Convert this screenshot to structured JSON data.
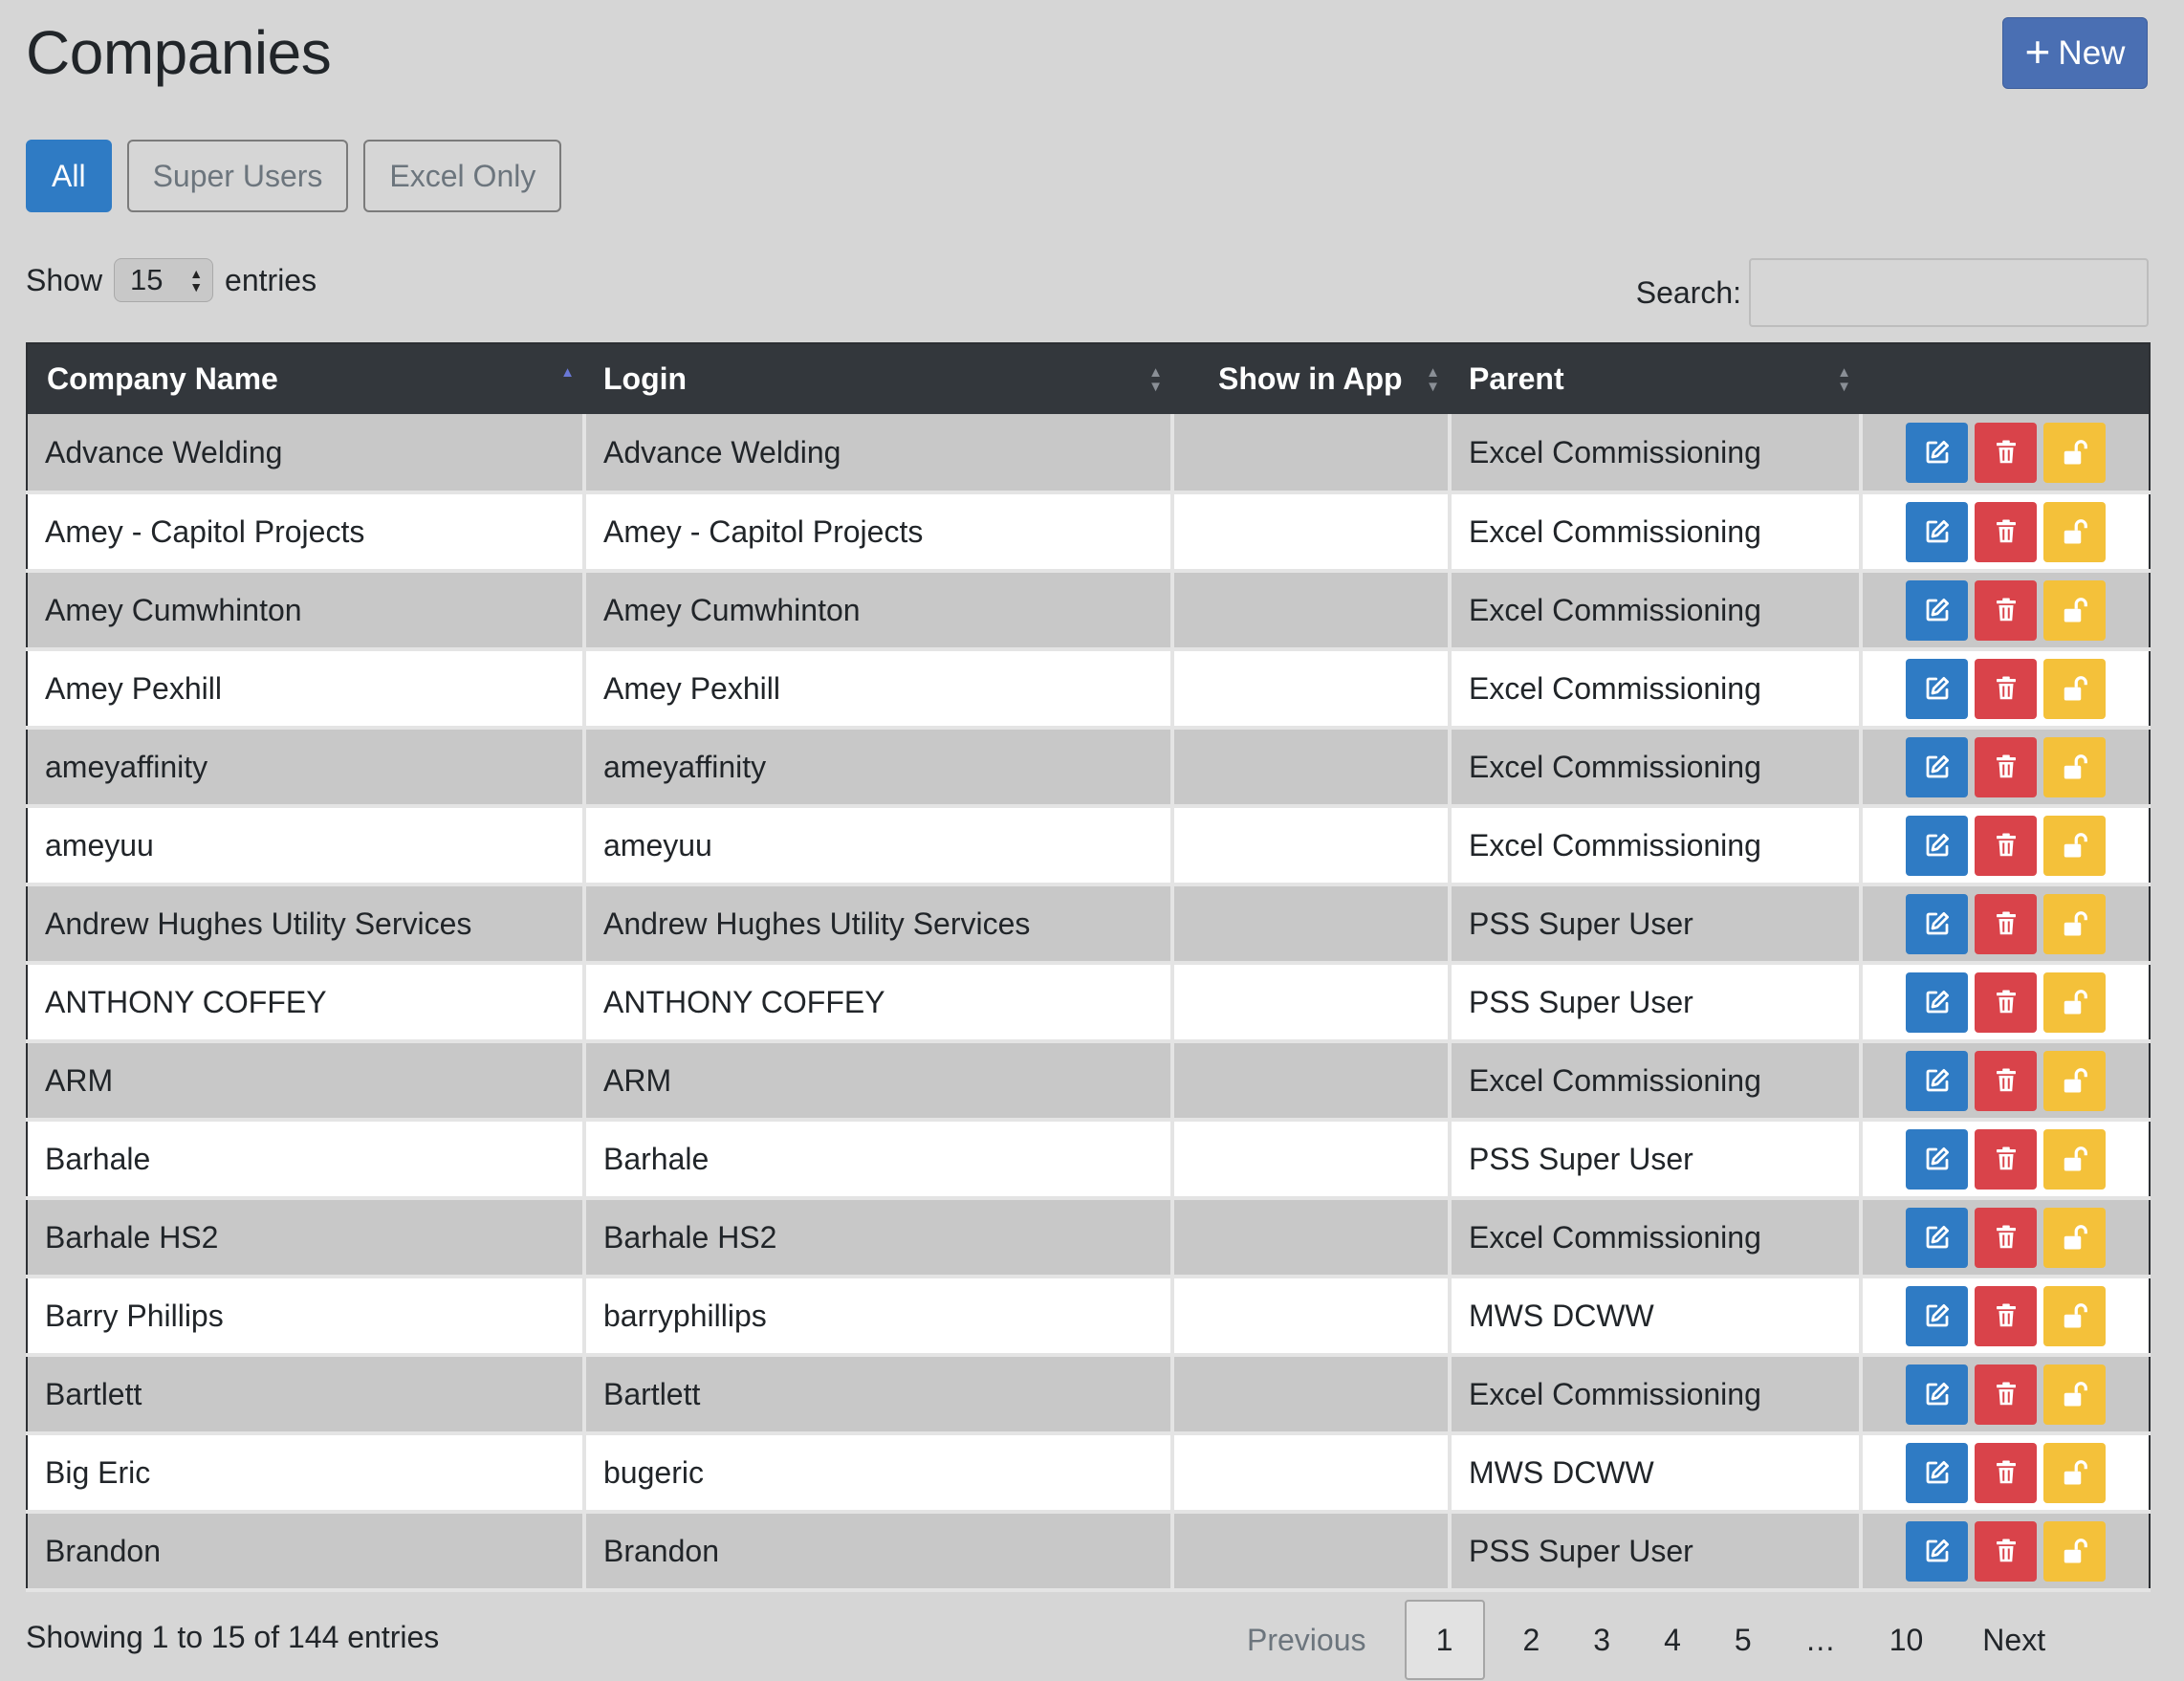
{
  "page": {
    "title": "Companies",
    "new_label": "New"
  },
  "filters": [
    {
      "label": "All",
      "active": true
    },
    {
      "label": "Super Users",
      "active": false
    },
    {
      "label": "Excel Only",
      "active": false
    }
  ],
  "length": {
    "show_label": "Show",
    "value": "15",
    "entries_label": "entries"
  },
  "search": {
    "label": "Search:",
    "value": "",
    "placeholder": ""
  },
  "table": {
    "columns": [
      "Company Name",
      "Login",
      "Show in App",
      "Parent",
      ""
    ],
    "rows": [
      {
        "name": "Advance Welding",
        "login": "Advance Welding",
        "show_in_app": "",
        "parent": "Excel Commissioning"
      },
      {
        "name": "Amey - Capitol Projects",
        "login": "Amey - Capitol Projects",
        "show_in_app": "",
        "parent": "Excel Commissioning"
      },
      {
        "name": "Amey Cumwhinton",
        "login": "Amey Cumwhinton",
        "show_in_app": "",
        "parent": "Excel Commissioning"
      },
      {
        "name": "Amey Pexhill",
        "login": "Amey Pexhill",
        "show_in_app": "",
        "parent": "Excel Commissioning"
      },
      {
        "name": "ameyaffinity",
        "login": "ameyaffinity",
        "show_in_app": "",
        "parent": "Excel Commissioning"
      },
      {
        "name": "ameyuu",
        "login": "ameyuu",
        "show_in_app": "",
        "parent": "Excel Commissioning"
      },
      {
        "name": "Andrew Hughes Utility Services",
        "login": "Andrew Hughes Utility Services",
        "show_in_app": "",
        "parent": "PSS Super User"
      },
      {
        "name": "ANTHONY COFFEY",
        "login": "ANTHONY COFFEY",
        "show_in_app": "",
        "parent": "PSS Super User"
      },
      {
        "name": "ARM",
        "login": "ARM",
        "show_in_app": "",
        "parent": "Excel Commissioning"
      },
      {
        "name": "Barhale",
        "login": "Barhale",
        "show_in_app": "",
        "parent": "PSS Super User"
      },
      {
        "name": "Barhale HS2",
        "login": "Barhale HS2",
        "show_in_app": "",
        "parent": "Excel Commissioning"
      },
      {
        "name": "Barry Phillips",
        "login": "barryphillips",
        "show_in_app": "",
        "parent": "MWS DCWW"
      },
      {
        "name": "Bartlett",
        "login": "Bartlett",
        "show_in_app": "",
        "parent": "Excel Commissioning"
      },
      {
        "name": "Big Eric",
        "login": "bugeric",
        "show_in_app": "",
        "parent": "MWS DCWW"
      },
      {
        "name": "Brandon",
        "login": "Brandon",
        "show_in_app": "",
        "parent": "PSS Super User"
      }
    ],
    "row_actions": [
      "edit-icon",
      "trash-icon",
      "unlock-icon"
    ]
  },
  "footer": {
    "info": "Showing 1 to 15 of 144 entries",
    "pagination": {
      "previous": "Previous",
      "pages": [
        "1",
        "2",
        "3",
        "4",
        "5",
        "…",
        "10"
      ],
      "current": "1",
      "next": "Next"
    }
  },
  "colors": {
    "background": "#d6d6d6",
    "primary": "#2f7bc4",
    "new_button": "#4a6fb3",
    "danger": "#d9434a",
    "warning": "#f4c13a",
    "table_header": "#33373c",
    "row_striped": "#c8c8c8",
    "row_plain": "#ffffff"
  }
}
